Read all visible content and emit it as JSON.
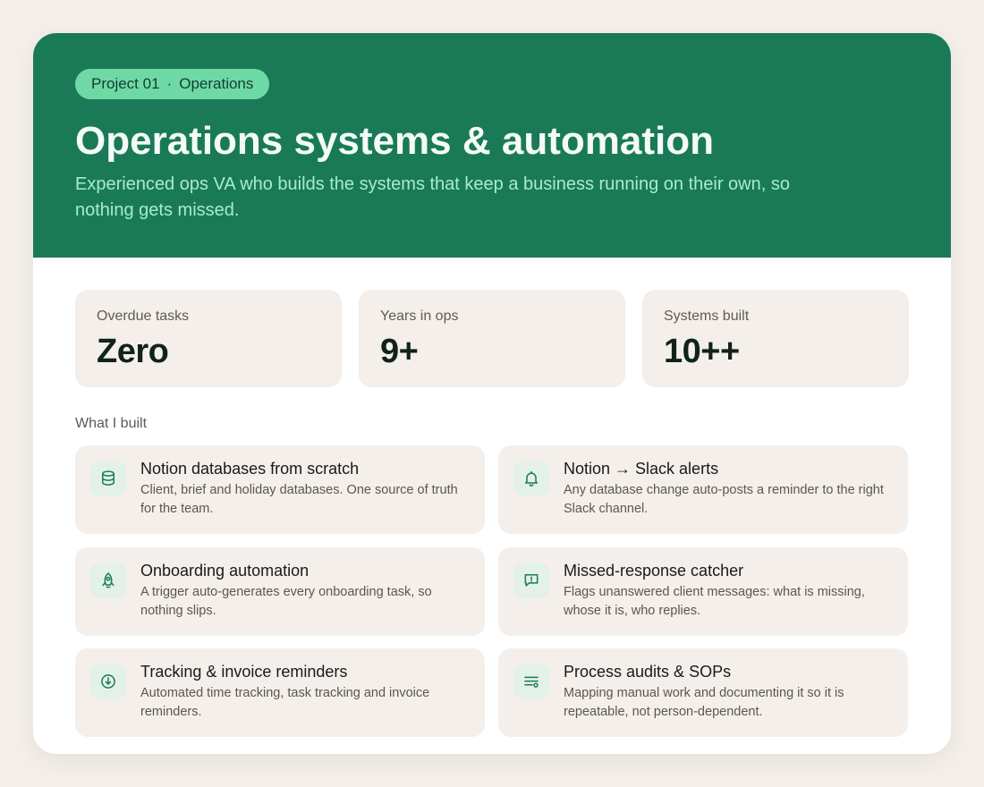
{
  "header": {
    "badge_project": "Project 01",
    "badge_separator": "·",
    "badge_category": "Operations",
    "title": "Operations systems & automation",
    "subtitle": "Experienced ops VA who builds the systems that keep a business running on their own, so nothing gets missed."
  },
  "stats": [
    {
      "label": "Overdue tasks",
      "value": "Zero"
    },
    {
      "label": "Years in ops",
      "value": "9+"
    },
    {
      "label": "Systems built",
      "value": "10++"
    }
  ],
  "section_label": "What I built",
  "features": [
    {
      "icon": "database-icon",
      "title": "Notion databases from scratch",
      "description": "Client, brief and holiday databases. One source of truth for the team."
    },
    {
      "icon": "bell-icon",
      "title": "Notion → Slack alerts",
      "description": "Any database change auto-posts a reminder to the right Slack channel."
    },
    {
      "icon": "rocket-icon",
      "title": "Onboarding automation",
      "description": "A trigger auto-generates every onboarding task, so nothing slips."
    },
    {
      "icon": "message-alert-icon",
      "title": "Missed-response catcher",
      "description": "Flags unanswered client messages: what is missing, whose it is, who replies."
    },
    {
      "icon": "clock-download-icon",
      "title": "Tracking & invoice reminders",
      "description": "Automated time tracking, task tracking and invoice reminders."
    },
    {
      "icon": "list-settings-icon",
      "title": "Process audits & SOPs",
      "description": "Mapping manual work and documenting it so it is repeatable, not person-dependent."
    }
  ],
  "colors": {
    "hero_background": "#1a7a58",
    "badge_background": "#6fd9a6",
    "card_tile": "#f4efea",
    "icon_tint": "#1a7a58"
  }
}
